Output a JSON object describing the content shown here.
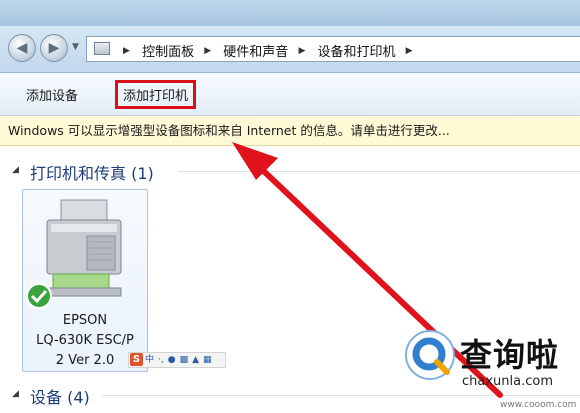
{
  "nav": {
    "back_icon": "back-arrow-icon",
    "forward_icon": "forward-arrow-icon",
    "breadcrumbs": [
      "控制面板",
      "硬件和声音",
      "设备和打印机"
    ]
  },
  "toolbar": {
    "add_device_label": "添加设备",
    "add_printer_label": "添加打印机"
  },
  "infobar": {
    "text": "Windows 可以显示增强型设备图标和来自 Internet 的信息。请单击进行更改..."
  },
  "sections": {
    "printers_label": "打印机和传真 (1)",
    "devices_label": "设备 (4)"
  },
  "device": {
    "line1": "EPSON",
    "line2": "LQ-630K ESC/P",
    "line3": "2 Ver 2.0",
    "default_status": "checkmark-icon"
  },
  "ime": {
    "s_label": "S",
    "item1": "中"
  },
  "watermark": {
    "brand": "查询啦",
    "url": "chaxunla.com",
    "url_small": "www.cooom.com"
  },
  "colors": {
    "highlight_box": "#d8101a",
    "arrow": "#e0121b",
    "infobar_bg": "#fff9d6"
  }
}
